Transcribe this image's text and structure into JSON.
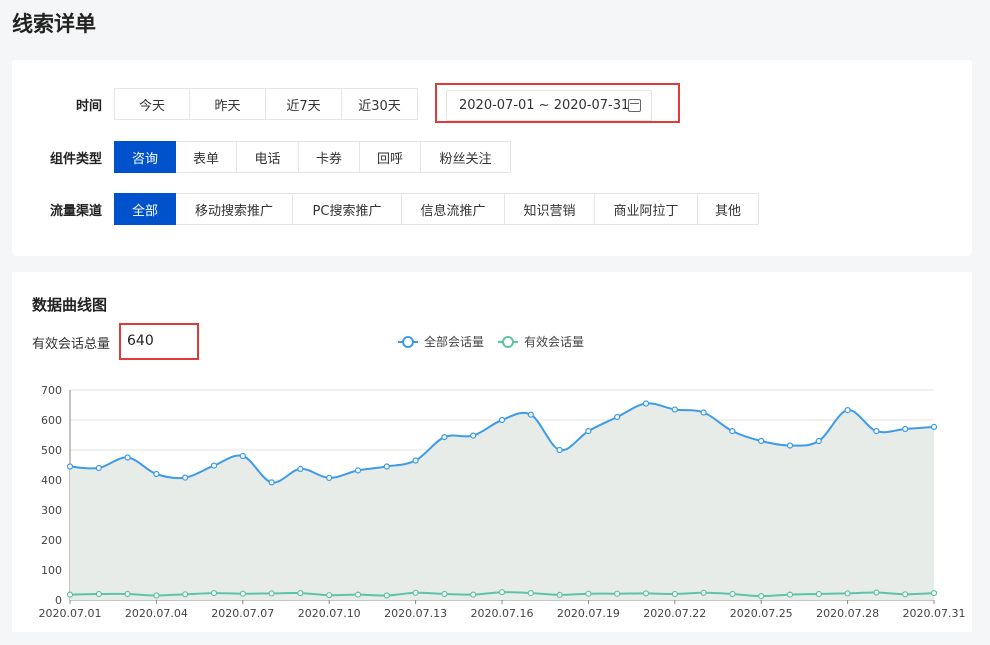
{
  "page": {
    "title": "线索详单"
  },
  "filters": {
    "time": {
      "label": "时间",
      "options": [
        "今天",
        "昨天",
        "近7天",
        "近30天"
      ],
      "date_range": "2020-07-01 ~ 2020-07-31"
    },
    "component": {
      "label": "组件类型",
      "options": [
        "咨询",
        "表单",
        "电话",
        "卡券",
        "回呼",
        "粉丝关注"
      ],
      "active": "咨询"
    },
    "channel": {
      "label": "流量渠道",
      "options": [
        "全部",
        "移动搜索推广",
        "PC搜索推广",
        "信息流推广",
        "知识营销",
        "商业阿拉丁",
        "其他"
      ],
      "active": "全部"
    }
  },
  "chart_section": {
    "title": "数据曲线图",
    "total_label": "有效会话总量",
    "total_value": "640"
  },
  "colors": {
    "accent": "#0052cc",
    "series1": "#3d9be9",
    "series2": "#5cc4a8",
    "area": "#e8ece9",
    "highlight": "#e03b3b"
  },
  "chart_data": {
    "type": "line",
    "x": [
      "2020.07.01",
      "2020.07.02",
      "2020.07.03",
      "2020.07.04",
      "2020.07.05",
      "2020.07.06",
      "2020.07.07",
      "2020.07.08",
      "2020.07.09",
      "2020.07.10",
      "2020.07.11",
      "2020.07.12",
      "2020.07.13",
      "2020.07.14",
      "2020.07.15",
      "2020.07.16",
      "2020.07.17",
      "2020.07.18",
      "2020.07.19",
      "2020.07.20",
      "2020.07.21",
      "2020.07.22",
      "2020.07.23",
      "2020.07.24",
      "2020.07.25",
      "2020.07.26",
      "2020.07.27",
      "2020.07.28",
      "2020.07.29",
      "2020.07.30",
      "2020.07.31"
    ],
    "x_tick_labels": [
      "2020.07.01",
      "2020.07.04",
      "2020.07.07",
      "2020.07.10",
      "2020.07.13",
      "2020.07.16",
      "2020.07.19",
      "2020.07.22",
      "2020.07.25",
      "2020.07.28",
      "2020.07.31"
    ],
    "series": [
      {
        "name": "全部会话量",
        "values": [
          445,
          440,
          475,
          420,
          408,
          448,
          480,
          392,
          437,
          407,
          432,
          445,
          465,
          543,
          548,
          600,
          618,
          500,
          563,
          610,
          655,
          635,
          625,
          563,
          530,
          515,
          530,
          633,
          563,
          570,
          577
        ],
        "area": true
      },
      {
        "name": "有效会话量",
        "values": [
          18,
          20,
          20,
          15,
          19,
          23,
          21,
          22,
          23,
          16,
          18,
          15,
          24,
          20,
          18,
          26,
          23,
          17,
          21,
          21,
          22,
          20,
          24,
          20,
          13,
          18,
          20,
          22,
          25,
          19,
          23
        ],
        "area": false
      }
    ],
    "ylim": [
      0,
      700
    ],
    "yticks": [
      0,
      100,
      200,
      300,
      400,
      500,
      600,
      700
    ],
    "grid": true,
    "legend": "top-center"
  }
}
